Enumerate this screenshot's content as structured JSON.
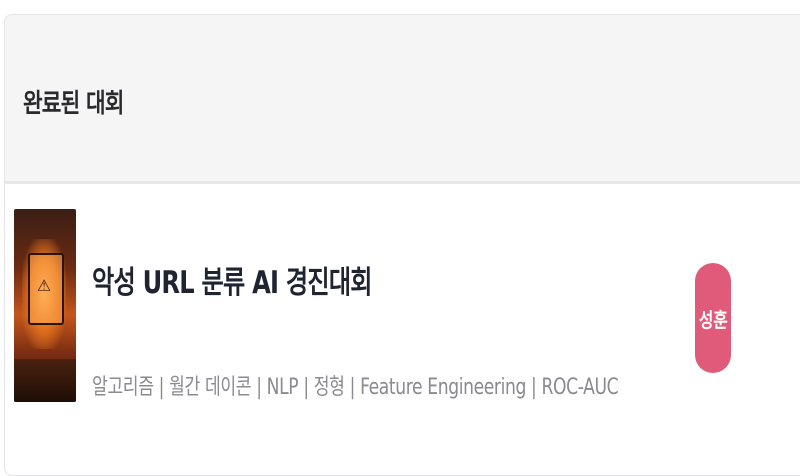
{
  "section": {
    "title": "완료된 대회"
  },
  "competition": {
    "title": "악성 URL 분류 AI 경진대회",
    "tags": "알고리즘 | 월간 데이콘 | NLP | 정형 | Feature Engineering | ROC-AUC",
    "thumbnail_icon": "warning-icon",
    "participant": {
      "avatar_text": "성훈",
      "color": "#e05b7a"
    }
  }
}
